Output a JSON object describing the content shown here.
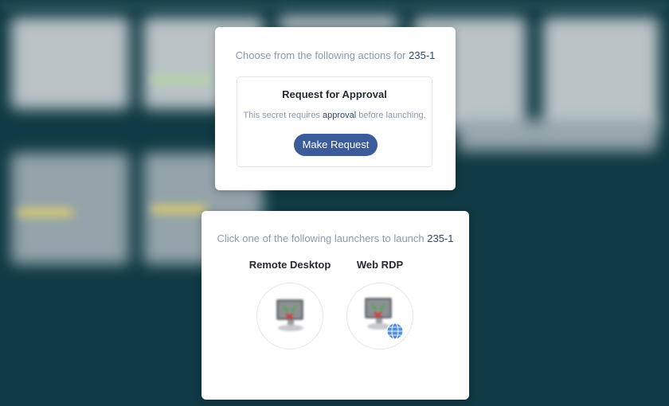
{
  "action_card": {
    "intro_prefix": "Choose from the following actions for ",
    "secret_name": "235-1",
    "approval": {
      "title": "Request for Approval",
      "desc_prefix": "This secret requires ",
      "desc_emphasis": "approval",
      "desc_suffix": " before launching.",
      "button_label": "Make Request"
    }
  },
  "launcher_card": {
    "intro_prefix": "Click one of the following launchers to launch ",
    "secret_name": "235-1",
    "launchers": [
      {
        "label": "Remote Desktop",
        "icon": "remote-desktop-icon"
      },
      {
        "label": "Web RDP",
        "icon": "web-rdp-icon"
      }
    ]
  },
  "colors": {
    "backdrop": "#103a45",
    "button": "#3b5b9a",
    "intro_text": "#8a9bb0",
    "emphasis_text": "#2d4a6a"
  }
}
